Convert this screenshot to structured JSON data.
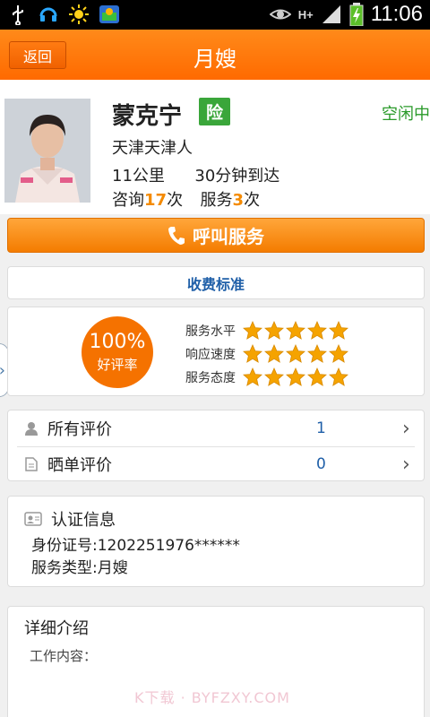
{
  "status_bar": {
    "time": "11:06",
    "network_label": "H+",
    "left_icons": [
      "usb-icon",
      "headset-icon",
      "sun-icon",
      "app-icon"
    ],
    "right_icons": [
      "eye-icon",
      "network-h-plus-icon",
      "signal-icon",
      "battery-charging-icon"
    ]
  },
  "header": {
    "back_label": "返回",
    "title": "月嫂"
  },
  "profile": {
    "name": "蒙克宁",
    "insurance_badge": "险",
    "status": "空闲中",
    "hometown": "天津天津人",
    "distance": "11公里",
    "arrival": "30分钟到达",
    "consult_prefix": "咨询",
    "consult_count": "17",
    "consult_suffix": "次",
    "service_prefix": "服务",
    "service_count": "3",
    "service_suffix": "次"
  },
  "call_button": {
    "label": "呼叫服务"
  },
  "fee_button": {
    "label": "收费标准"
  },
  "rating": {
    "percent": "100%",
    "percent_label": "好评率",
    "items": [
      {
        "label": "服务水平",
        "stars": 5
      },
      {
        "label": "响应速度",
        "stars": 5
      },
      {
        "label": "服务态度",
        "stars": 5
      }
    ]
  },
  "reviews": [
    {
      "label": "所有评价",
      "count": "1"
    },
    {
      "label": "晒单评价",
      "count": "0"
    }
  ],
  "certification": {
    "title": "认证信息",
    "id_line": "身份证号:1202251976******",
    "type_line": "服务类型:月嫂"
  },
  "details": {
    "title": "详细介绍",
    "work_label": "工作内容："
  },
  "watermark": "K下载 · BYFZXY.COM",
  "colors": {
    "accent": "#ff7300",
    "status_green": "#2a9a2a",
    "link_blue": "#1f5fa8",
    "star": "#f5a300"
  }
}
